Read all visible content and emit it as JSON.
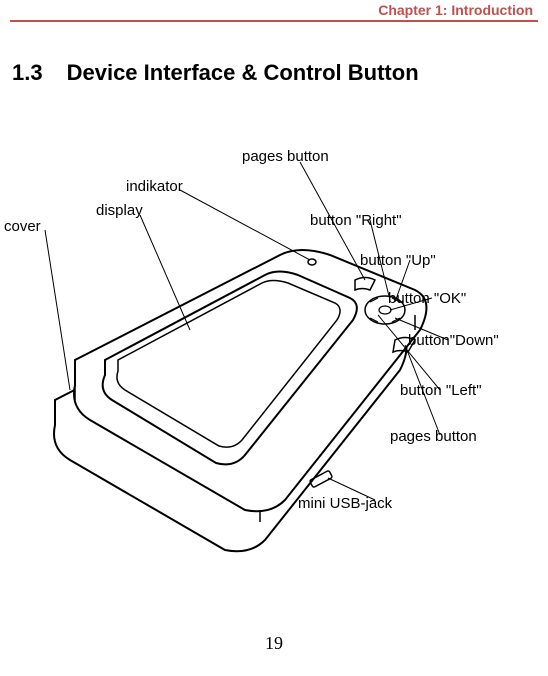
{
  "header": {
    "chapter": "Chapter 1: Introduction"
  },
  "section": {
    "number": "1.3",
    "title": "Device Interface & Control Button"
  },
  "labels": {
    "pages_button_top": "pages button",
    "indikator": "indikator",
    "display": "display",
    "cover": "cover",
    "button_right": "button \"Right\"",
    "button_up": "button \"Up\"",
    "button_ok": "button \"OK\"",
    "button_down": "button\"Down\"",
    "button_left": "button \"Left\"",
    "pages_button_bottom": "pages button",
    "mini_usb": "mini USB-jack"
  },
  "page_number": "19"
}
